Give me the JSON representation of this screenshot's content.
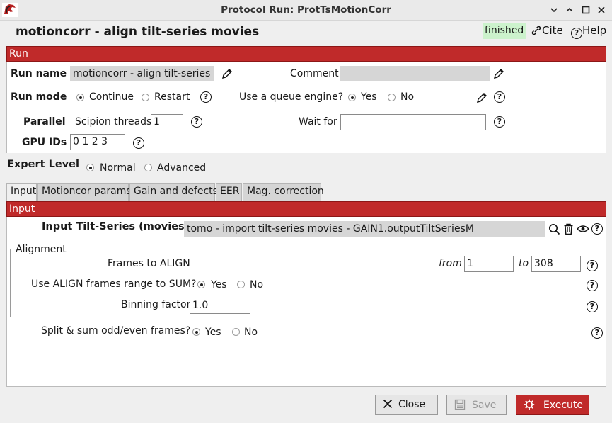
{
  "window": {
    "title": "Protocol Run: ProtTsMotionCorr"
  },
  "header": {
    "protocol_title": "motioncorr - align tilt-series movies",
    "status": "finished",
    "cite_label": "Cite",
    "help_label": "Help"
  },
  "run_section": {
    "title": "Run",
    "run_name_label": "Run name",
    "run_name_value": "motioncorr - align tilt-series movies",
    "comment_label": "Comment",
    "comment_value": "",
    "run_mode_label": "Run mode",
    "run_mode_options": [
      "Continue",
      "Restart"
    ],
    "run_mode_selected": "Continue",
    "queue_label": "Use a queue engine?",
    "queue_options": [
      "Yes",
      "No"
    ],
    "queue_selected": "Yes",
    "parallel_label": "Parallel",
    "threads_label": "Scipion threads",
    "threads_value": "1",
    "wait_for_label": "Wait for",
    "wait_for_value": "",
    "gpu_label": "GPU IDs",
    "gpu_value": "0 1 2 3"
  },
  "expert_level": {
    "label": "Expert Level",
    "options": [
      "Normal",
      "Advanced"
    ],
    "selected": "Normal"
  },
  "tabs": [
    {
      "label": "Input",
      "active": true
    },
    {
      "label": "Motioncor params",
      "active": false
    },
    {
      "label": "Gain and defects",
      "active": false
    },
    {
      "label": "EER",
      "active": false
    },
    {
      "label": "Mag. correction",
      "active": false
    }
  ],
  "input_section": {
    "title": "Input",
    "tilt_series_label": "Input Tilt-Series (movies)",
    "tilt_series_value": "tomo - import tilt-series movies - GAIN1.outputTiltSeriesM",
    "alignment": {
      "legend": "Alignment",
      "frames_label": "Frames to ALIGN",
      "from_label": "from",
      "from_value": "1",
      "to_label": "to",
      "to_value": "308",
      "range_sum_label": "Use ALIGN frames range to SUM?",
      "range_sum_options": [
        "Yes",
        "No"
      ],
      "range_sum_selected": "Yes",
      "binning_label": "Binning factor",
      "binning_value": "1.0"
    },
    "split_label": "Split & sum odd/even frames?",
    "split_options": [
      "Yes",
      "No"
    ],
    "split_selected": "Yes"
  },
  "footer": {
    "close_label": "Close",
    "save_label": "Save",
    "execute_label": "Execute"
  },
  "colors": {
    "accent": "#c02a2a",
    "status_bg": "#ccf2cc"
  },
  "icons": [
    "scipion-logo-icon",
    "minimize-icon",
    "restore-icon",
    "maximize-icon",
    "close-icon",
    "link-icon",
    "help-icon",
    "pencil-icon",
    "search-icon",
    "trash-icon",
    "eye-icon",
    "close-x-icon",
    "save-icon",
    "gear-icon"
  ]
}
